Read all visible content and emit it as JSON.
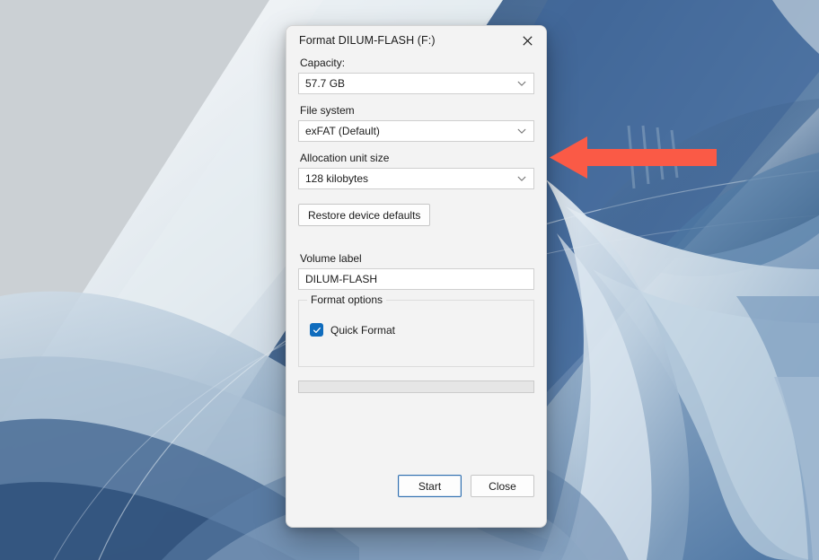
{
  "dialog": {
    "title": "Format DILUM-FLASH (F:)",
    "close_icon": "close-icon",
    "fields": {
      "capacity": {
        "label": "Capacity:",
        "value": "57.7 GB",
        "chevron_icon": "chevron-down-icon"
      },
      "file_system": {
        "label": "File system",
        "value": "exFAT (Default)",
        "chevron_icon": "chevron-down-icon"
      },
      "allocation_unit_size": {
        "label": "Allocation unit size",
        "value": "128 kilobytes",
        "chevron_icon": "chevron-down-icon"
      },
      "volume_label": {
        "label": "Volume label",
        "value": "DILUM-FLASH"
      }
    },
    "restore_defaults_button": "Restore device defaults",
    "format_options": {
      "legend": "Format options",
      "quick_format": {
        "label": "Quick Format",
        "checked": "true",
        "check_icon": "checkmark-icon"
      }
    },
    "progress": {
      "percent": "0"
    },
    "buttons": {
      "start": "Start",
      "close": "Close"
    }
  },
  "annotation": {
    "arrow_icon": "left-arrow-icon",
    "arrow_color": "#fa5a46"
  },
  "desktop": {
    "wallpaper_name": "windows-bloom-wallpaper"
  },
  "colors": {
    "accent": "#0f6cbd",
    "dialog_bg": "#f3f3f3",
    "arrow": "#fa5a46",
    "default_button_border": "#2f6fb0"
  }
}
